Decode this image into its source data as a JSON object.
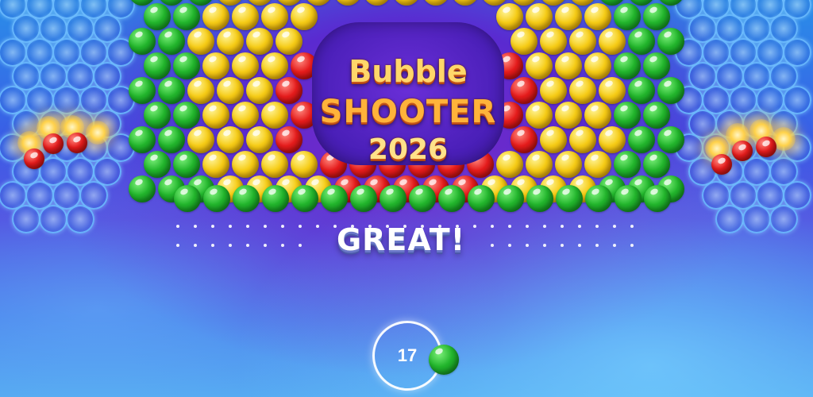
{
  "title": {
    "line1": "Bubble",
    "line2": "SHOOTER",
    "line3": "2026"
  },
  "feedback_text": "GREAT!",
  "shooter": {
    "shots_remaining": "17",
    "next_bubble_color": "green"
  },
  "colors": {
    "green": "#22b52c",
    "yellow": "#f6cc16",
    "red": "#e51c1c",
    "frost": "#6ebeff"
  },
  "icons": {
    "frost_bubble": "frozen-bubble-icon",
    "spark_bubble": "spark-bubble-icon"
  }
}
